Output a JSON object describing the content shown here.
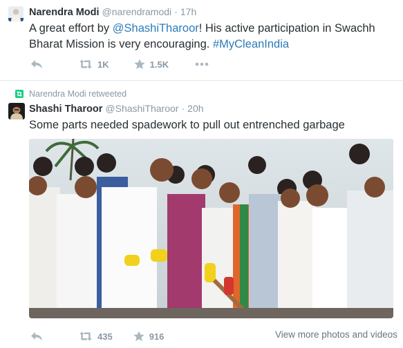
{
  "tweet1": {
    "name": "Narendra Modi",
    "handle": "@narendramodi",
    "separator": "·",
    "time": "17h",
    "text_parts": {
      "before": "A great effort by ",
      "mention": "@ShashiTharoor",
      "middle": "! His active participation in Swachh Bharat Mission is very encouraging. ",
      "hashtag": "#MyCleanIndia"
    },
    "retweets": "1K",
    "likes": "1.5K"
  },
  "retweet_note": "Narendra Modi retweeted",
  "tweet2": {
    "name": "Shashi Tharoor",
    "handle": "@ShashiTharoor",
    "separator": "·",
    "time": "20h",
    "text": "Some parts needed spadework to pull out entrenched garbage",
    "retweets": "435",
    "likes": "916",
    "more_photos": "View more photos and videos"
  },
  "colors": {
    "link": "#2b7bb9",
    "muted": "#8899a6",
    "retweet_green": "#19cf86"
  }
}
